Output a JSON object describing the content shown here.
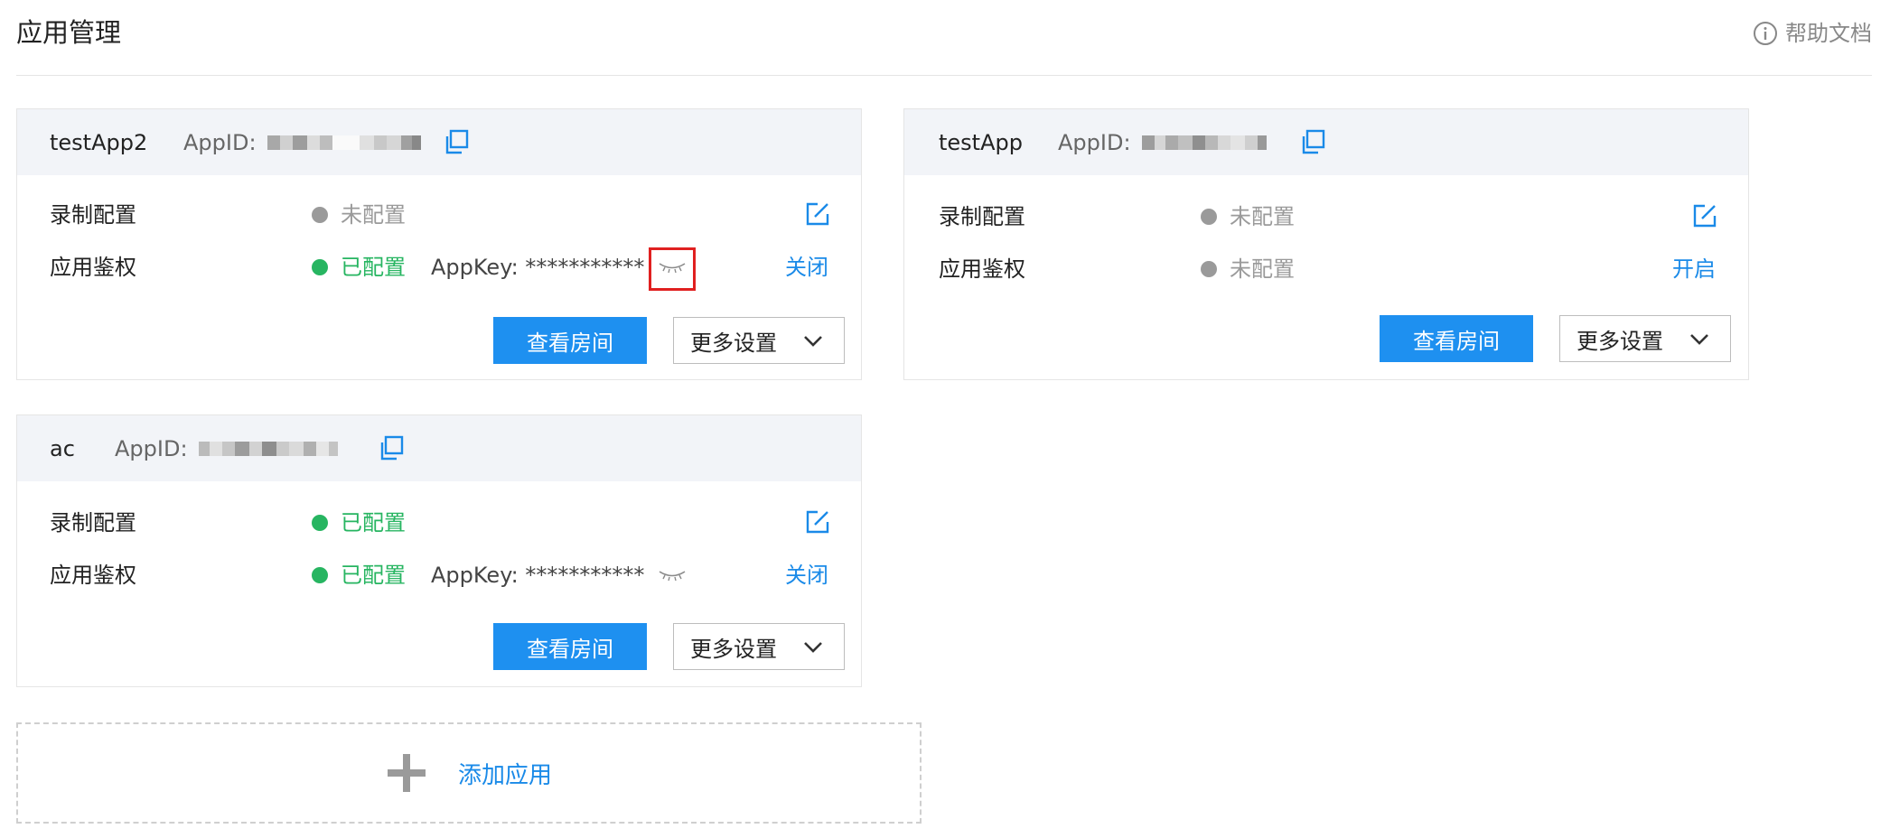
{
  "header": {
    "title": "应用管理",
    "help_label": "帮助文档"
  },
  "apps": [
    {
      "name": "testApp2",
      "appid_label": "AppID:",
      "recording": {
        "label": "录制配置",
        "status": "未配置"
      },
      "auth": {
        "label": "应用鉴权",
        "status": "已配置",
        "appkey": "AppKey: ***********",
        "toggle": "关闭"
      },
      "view_rooms": "查看房间",
      "more_settings": "更多设置"
    },
    {
      "name": "testApp",
      "appid_label": "AppID:",
      "recording": {
        "label": "录制配置",
        "status": "未配置"
      },
      "auth": {
        "label": "应用鉴权",
        "status": "未配置",
        "toggle": "开启"
      },
      "view_rooms": "查看房间",
      "more_settings": "更多设置"
    },
    {
      "name": "ac",
      "appid_label": "AppID:",
      "recording": {
        "label": "录制配置",
        "status": "已配置"
      },
      "auth": {
        "label": "应用鉴权",
        "status": "已配置",
        "appkey": "AppKey: ***********",
        "toggle": "关闭"
      },
      "view_rooms": "查看房间",
      "more_settings": "更多设置"
    }
  ],
  "add_app": {
    "label": "添加应用"
  },
  "colors": {
    "accent": "#1e90f0",
    "link": "#1a8ae8",
    "configured": "#27b561",
    "unconfigured": "#9a9a9a",
    "card_header_bg": "#f2f4f8",
    "highlight": "#e02020"
  },
  "icons": [
    "info-icon",
    "copy-icon",
    "edit-icon",
    "eye-closed-icon",
    "chevron-down-icon",
    "plus-icon"
  ]
}
